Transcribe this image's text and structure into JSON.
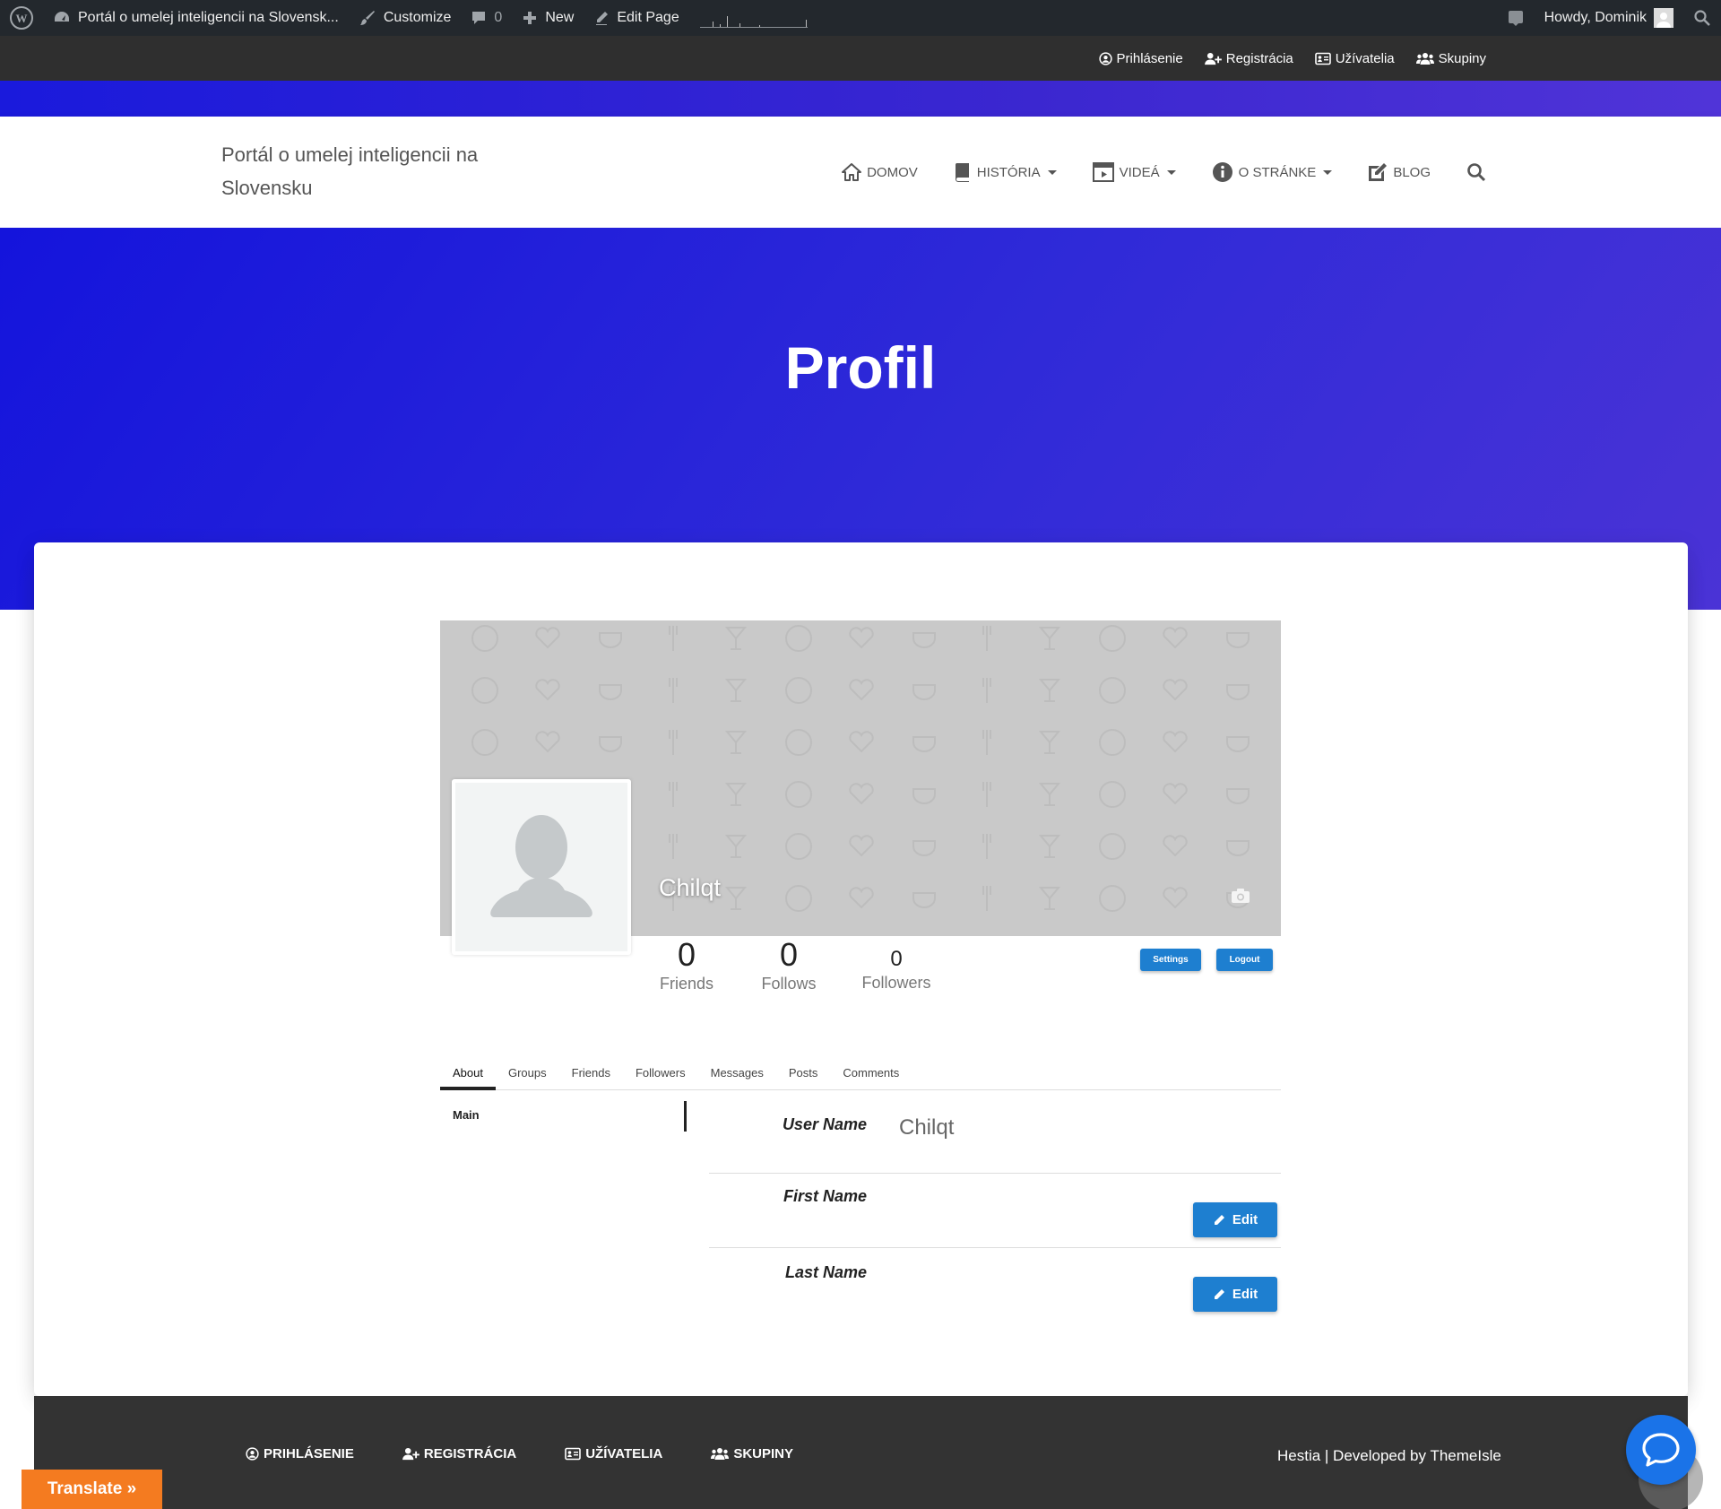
{
  "admin_bar": {
    "site_name": "Portál o umelej inteligencii na Slovensk...",
    "customize": "Customize",
    "comments_count": "0",
    "new": "New",
    "edit_page": "Edit Page",
    "greeting": "Howdy, Dominik"
  },
  "top_links": [
    "Prihlásenie",
    "Registrácia",
    "Užívatelia",
    "Skupiny"
  ],
  "brand": "Portál o umelej inteligencii na Slovensku",
  "menu": {
    "home": "DOMOV",
    "history": "HISTÓRIA",
    "videos": "VIDEÁ",
    "about": "O STRÁNKE",
    "blog": "BLOG"
  },
  "hero": {
    "title": "Profil"
  },
  "profile": {
    "username": "Chilqt",
    "stats": [
      {
        "value": "0",
        "label": "Friends"
      },
      {
        "value": "0",
        "label": "Follows"
      },
      {
        "value": "0",
        "label": "Followers"
      }
    ],
    "settings_label": "Settings",
    "logout_label": "Logout"
  },
  "tabs": [
    "About",
    "Groups",
    "Friends",
    "Followers",
    "Messages",
    "Posts",
    "Comments"
  ],
  "active_tab": "About",
  "sidebar": {
    "main_label": "Main"
  },
  "fields": [
    {
      "label": "User Name",
      "value": "Chilqt"
    },
    {
      "label": "First Name",
      "value": ""
    },
    {
      "label": "Last Name",
      "value": ""
    }
  ],
  "edit_label": "Edit",
  "footer": {
    "links": [
      "PRIHLÁSENIE",
      "REGISTRÁCIA",
      "UŽÍVATELIA",
      "SKUPINY"
    ],
    "credit_prefix": "Hestia | Developed by ",
    "credit_author": "ThemeIsle"
  },
  "translate_label": "Translate »",
  "colors": {
    "admin_bar": "#23282d",
    "hero_blue": "#1414dc",
    "hero_violet": "#4a33d6",
    "button_blue": "#1e7fd0",
    "translate_orange": "#f47b20",
    "footer": "#333333"
  }
}
